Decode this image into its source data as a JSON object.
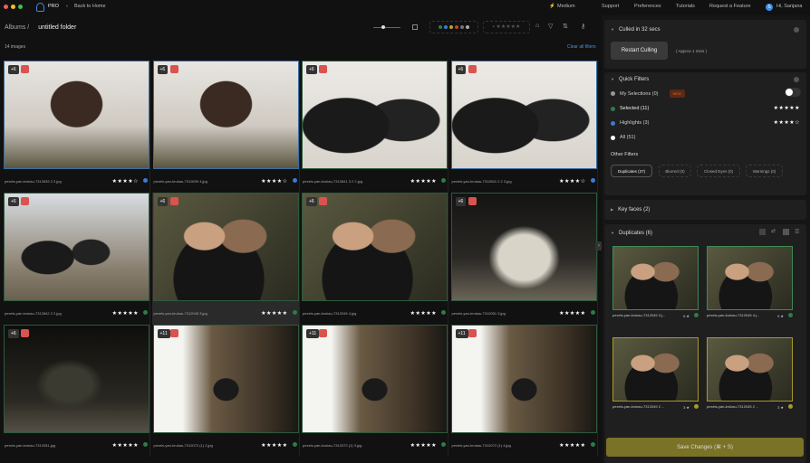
{
  "topbar": {
    "app_badge": "PRO",
    "back": "Back to Home",
    "speed": "Medium",
    "links": [
      "Support",
      "Preferences",
      "Tutorials",
      "Request a Feature"
    ],
    "user": "Hi, Sanjana",
    "avatar_initial": "S"
  },
  "main": {
    "breadcrumb_root": "Albums",
    "breadcrumb_sep": "/",
    "folder": "untitled folder",
    "count": "14 images",
    "clear_filters": "Clear all filters",
    "images": [
      {
        "badge": "+6",
        "name": "pexels-yan-krukau-7312839 2 2.jpg",
        "stars": "★★★★☆",
        "color": "#3a7bd5",
        "photo": "p1",
        "frame": "blue"
      },
      {
        "badge": "+6",
        "name": "pexels-yan-krukau-7312839 4.jpg",
        "stars": "★★★★☆",
        "color": "#3a7bd5",
        "photo": "p1",
        "frame": "blue"
      },
      {
        "badge": "+6",
        "name": "pexels-yan-krukau-7312841 3 2 2.jpg",
        "stars": "★★★★★",
        "color": "#2f7a4a",
        "photo": "p2",
        "frame": "green"
      },
      {
        "badge": "+6",
        "name": "pexels-yan-krukau-7312841 2 2 3.jpg",
        "stars": "★★★★☆",
        "color": "#3a7bd5",
        "photo": "p2",
        "frame": "blue"
      },
      {
        "badge": "+6",
        "name": "pexels-yan-krukau-7312842 2 2.jpg",
        "stars": "★★★★★",
        "color": "#2f7a4a",
        "photo": "p3",
        "frame": "green"
      },
      {
        "badge": "+6",
        "name": "pexels-yan-krukau-7312045 3.jpg",
        "stars": "★★★★★",
        "color": "#2f7a4a",
        "photo": "p4",
        "frame": "green"
      },
      {
        "badge": "+6",
        "name": "pexels-yan-krukau-7312045 4.jpg",
        "stars": "★★★★★",
        "color": "#2f7a4a",
        "photo": "p4",
        "frame": "green"
      },
      {
        "badge": "+6",
        "name": "pexels-yan-krukau-7312051 3.jpg",
        "stars": "★★★★★",
        "color": "#2f7a4a",
        "photo": "p5",
        "frame": "green"
      },
      {
        "badge": "+6",
        "name": "pexels-yan-krukau-7312051.jpg",
        "stars": "★★★★★",
        "color": "#2f7a4a",
        "photo": "p7",
        "frame": "green"
      },
      {
        "badge": "+11",
        "name": "pexels-yan-krukau-7312072 (1) 2.jpg",
        "stars": "★★★★★",
        "color": "#2f7a4a",
        "photo": "p6",
        "frame": "green"
      },
      {
        "badge": "+11",
        "name": "pexels-yan-krukau-7312072 (1) 3.jpg",
        "stars": "★★★★★",
        "color": "#2f7a4a",
        "photo": "p6",
        "frame": "green"
      },
      {
        "badge": "+11",
        "name": "pexels-yan-krukau-7312072 (1) 4.jpg",
        "stars": "★★★★★",
        "color": "#2f7a4a",
        "photo": "p6",
        "frame": "green"
      }
    ]
  },
  "right": {
    "culled": "Culled in 32 secs",
    "restart": "Restart Culling",
    "approx": "( Approx 1 mins )",
    "quick_filters": "Quick Filters",
    "my_selections": "My Selections (0)",
    "new_badge": "NEW",
    "selected": "Selected (11)",
    "selected_stars": "★★★★★",
    "highlights": "Highlights (3)",
    "highlights_stars": "★★★★☆",
    "all": "All (51)",
    "other_filters": "Other Filters",
    "pills": [
      "Duplicates (37)",
      "Blurred (0)",
      "Closed Eyes (0)",
      "Warnings (0)"
    ],
    "key_faces": "Key faces (2)",
    "duplicates": "Duplicates (6)",
    "dups": [
      {
        "name": "pexels-yan-krukau-7312045 3.j...",
        "rating": "5 ★"
      },
      {
        "name": "pexels-yan-krukau-7312045 4.j...",
        "rating": "5 ★"
      },
      {
        "name": "pexels-yan-krukau-7312045 2 ...",
        "rating": "3 ★"
      },
      {
        "name": "pexels-yan-krukau-7312045 2 ...",
        "rating": "3 ★"
      }
    ],
    "save": "Save Changes (⌘ + S)"
  }
}
